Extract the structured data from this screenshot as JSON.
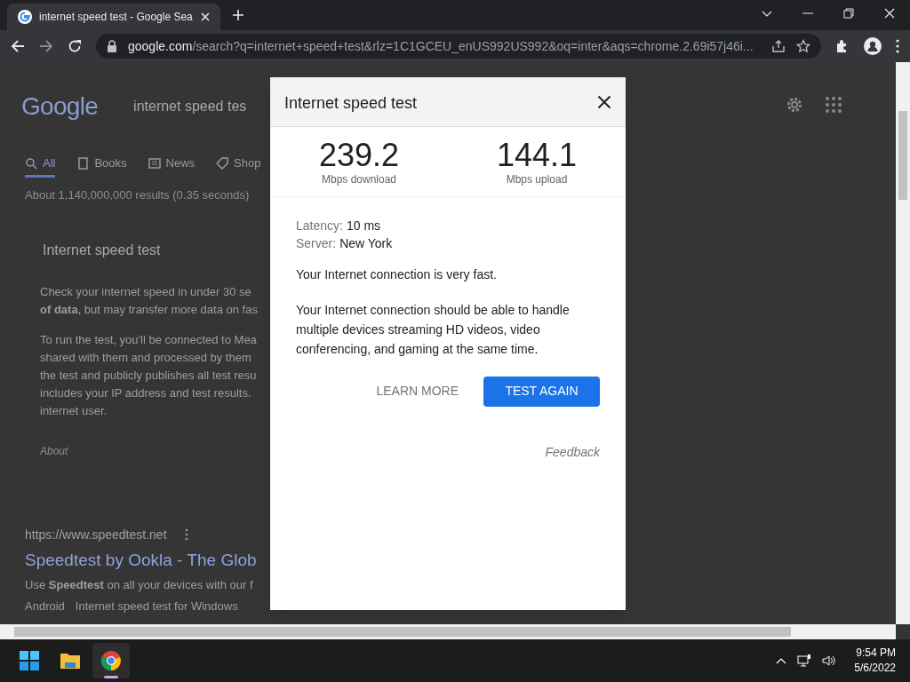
{
  "browser": {
    "tab": {
      "title": "internet speed test - Google Sea",
      "selected": true
    },
    "address": {
      "host": "google.com",
      "path": "/search?q=internet+speed+test&rlz=1C1GCEU_enUS992US992&oq=inter&aqs=chrome.2.69i57j46i..."
    }
  },
  "page": {
    "logo": "Google",
    "search_value": "internet speed tes",
    "tabs": [
      {
        "label": "All",
        "selected": true
      },
      {
        "label": "Books",
        "selected": false
      },
      {
        "label": "News",
        "selected": false
      },
      {
        "label": "Shop",
        "selected": false
      }
    ],
    "result_stats": "About 1,140,000,000 results (0.35 seconds)",
    "card_title": "Internet speed test",
    "paragraphs": [
      [
        "Check your internet speed in under 30 se",
        "**of data**, but may transfer more data on fas"
      ],
      [
        "To run the test, you'll be connected to Mea",
        "shared with them and processed by them",
        "the test and publicly publishes all test resu",
        "includes your IP address and test results.",
        "internet user."
      ]
    ],
    "about": "About",
    "result": {
      "url": "https://www.speedtest.net",
      "title": "Speedtest by Ookla - The Glob",
      "snippet": "Use **Speedtest** on all your devices with our f",
      "links": [
        "Android",
        "Internet speed test for Windows"
      ]
    }
  },
  "dialog": {
    "title": "Internet speed test",
    "stats": [
      {
        "value": "239.2",
        "label": "Mbps download"
      },
      {
        "value": "144.1",
        "label": "Mbps upload"
      }
    ],
    "details": [
      {
        "label": "Latency:",
        "value": "10 ms"
      },
      {
        "label": "Server:",
        "value": "New York"
      }
    ],
    "summary": "Your Internet connection is very fast.",
    "description": "Your Internet connection should be able to handle multiple devices streaming HD videos, video conferencing, and gaming at the same time.",
    "secondary_button": "LEARN MORE",
    "primary_button": "TEST AGAIN",
    "feedback": "Feedback"
  },
  "taskbar": {
    "apps": [
      {
        "kind": "start",
        "selected": false
      },
      {
        "kind": "files",
        "selected": false
      },
      {
        "kind": "browser",
        "selected": true
      }
    ],
    "time": "9:54 PM",
    "date": "5/6/2022"
  }
}
